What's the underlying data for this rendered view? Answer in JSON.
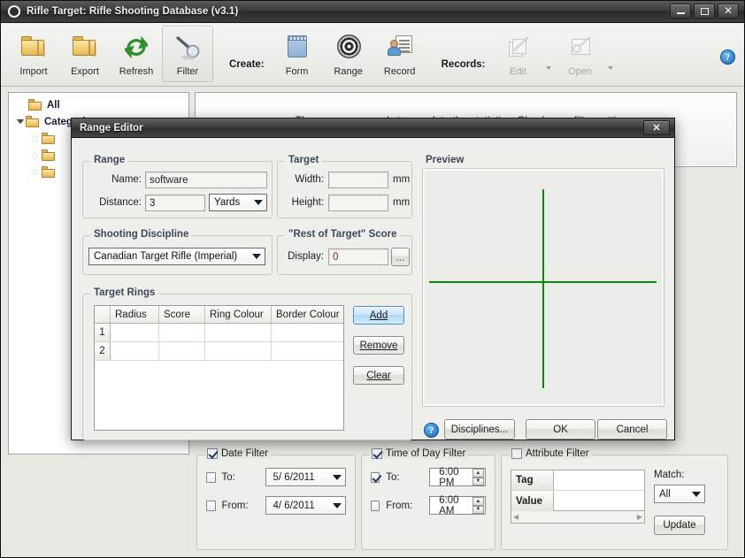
{
  "window": {
    "title": "Rifle Target: Rifle Shooting Database (v3.1)",
    "minimize_label": "–",
    "maximize_label": "□",
    "close_label": "✕"
  },
  "toolbar": {
    "items": [
      {
        "label": "Import",
        "icon": "folder-icon",
        "state": "enabled"
      },
      {
        "label": "Export",
        "icon": "folder-icon",
        "state": "enabled"
      },
      {
        "label": "Refresh",
        "icon": "refresh-icon",
        "state": "enabled"
      },
      {
        "label": "Filter",
        "icon": "magnifier-icon",
        "state": "active"
      }
    ],
    "create_group_label": "Create:",
    "create_items": [
      {
        "label": "Form",
        "icon": "notepad-icon"
      },
      {
        "label": "Range",
        "icon": "target-rings-icon"
      },
      {
        "label": "Record",
        "icon": "person-card-icon"
      }
    ],
    "records_group_label": "Records:",
    "records_items": [
      {
        "label": "Edit",
        "icon": "pencil-pages-icon",
        "state": "disabled"
      },
      {
        "label": "Open",
        "icon": "open-document-icon",
        "state": "disabled"
      }
    ],
    "help_label": "?"
  },
  "sidebar": {
    "items": [
      {
        "label": "All",
        "expander": "none",
        "icon": "folder-icon"
      },
      {
        "label": "Categories",
        "expander": "expanded",
        "icon": "folder-icon"
      },
      {
        "label": "",
        "expander": "collapsed",
        "icon": "folder-icon"
      },
      {
        "label": "",
        "expander": "collapsed",
        "icon": "folder-icon"
      },
      {
        "label": "",
        "expander": "collapsed",
        "icon": "folder-icon"
      }
    ]
  },
  "main": {
    "message": "There are no records to populate the statistics. Check your filter settings."
  },
  "filters": {
    "date": {
      "legend": "Date Filter",
      "enabled": true,
      "to_label": "To:",
      "to_checked": false,
      "to_value": "5/  6/2011",
      "from_label": "From:",
      "from_checked": false,
      "from_value": "4/  6/2011"
    },
    "time": {
      "legend": "Time of Day Filter",
      "enabled": true,
      "to_label": "To:",
      "to_checked": true,
      "to_value": "6:00 PM",
      "from_label": "From:",
      "from_checked": false,
      "from_value": "6:00 AM"
    },
    "attribute": {
      "legend": "Attribute Filter",
      "enabled": false,
      "rows": [
        {
          "header": "Tag",
          "value": ""
        },
        {
          "header": "Value",
          "value": ""
        }
      ],
      "match_label": "Match:",
      "match_value": "All",
      "update_label": "Update"
    }
  },
  "dialog": {
    "title": "Range Editor",
    "close_label": "✕",
    "range": {
      "legend": "Range",
      "name_label": "Name:",
      "name_value": "software",
      "distance_label": "Distance:",
      "distance_value": "3",
      "units_value": "Yards"
    },
    "target": {
      "legend": "Target",
      "width_label": "Width:",
      "width_value": "",
      "width_units": "mm",
      "height_label": "Height:",
      "height_value": "",
      "height_units": "mm"
    },
    "discipline": {
      "legend": "Shooting Discipline",
      "value": "Canadian Target Rifle (Imperial)"
    },
    "rest_of_target": {
      "legend": "\"Rest of Target\" Score",
      "display_label": "Display:",
      "display_value": "0",
      "browse_label": "..."
    },
    "target_rings": {
      "legend": "Target Rings",
      "columns": [
        "",
        "Radius",
        "Score",
        "Ring Colour",
        "Border Colour"
      ],
      "rows": [
        {
          "index": "1",
          "radius": "",
          "score": "",
          "ring_colour": "",
          "border_colour": ""
        },
        {
          "index": "2",
          "radius": "",
          "score": "",
          "ring_colour": "",
          "border_colour": ""
        }
      ],
      "add_label": "Add",
      "remove_label": "Remove",
      "clear_label": "Clear"
    },
    "preview": {
      "legend": "Preview",
      "crosshair_colour": "#0a8a12"
    },
    "footer": {
      "help_label": "?",
      "disciplines_label": "Disciplines...",
      "ok_label": "OK",
      "cancel_label": "Cancel"
    }
  }
}
